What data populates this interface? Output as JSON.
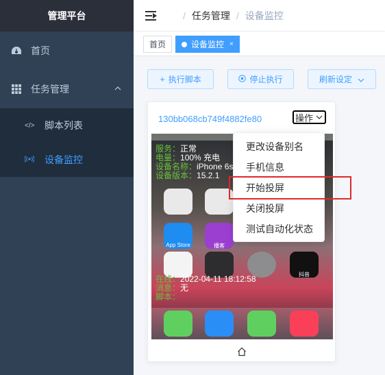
{
  "app": {
    "title": "管理平台"
  },
  "sidebar": {
    "items": [
      {
        "label": "首页",
        "icon": "dashboard-icon"
      },
      {
        "label": "任务管理",
        "icon": "table-grid-icon",
        "expanded": true
      }
    ],
    "subitems": [
      {
        "label": "脚本列表",
        "icon": "code-icon"
      },
      {
        "label": "设备监控",
        "icon": "broadcast-icon",
        "active": true
      }
    ]
  },
  "breadcrumb": {
    "level1": "任务管理",
    "level2": "设备监控"
  },
  "tags": [
    {
      "label": "首页"
    },
    {
      "label": "设备监控",
      "active": true,
      "close": "×"
    }
  ],
  "toolbar": {
    "run_label": "执行脚本",
    "stop_label": "停止执行",
    "refresh_label": "刷新设定"
  },
  "device": {
    "id": "130bb068cb749f4882fe80",
    "ops_label": "操作",
    "overlay_top": [
      {
        "key": "服务：",
        "value": "正常"
      },
      {
        "key": "电量：",
        "value": "100% 充电"
      },
      {
        "key": "设备名称：",
        "value": "iPhone 6s"
      },
      {
        "key": "设备版本：",
        "value": "15.2.1"
      }
    ],
    "overlay_bottom": [
      {
        "key": "在线：",
        "value": "2022-04-11 18:12:58"
      },
      {
        "key": "消息：",
        "value": "无"
      },
      {
        "key": "脚本：",
        "value": ""
      }
    ],
    "apps": [
      {
        "label": "App Store",
        "color": "#1e8cf0"
      },
      {
        "label": "播客",
        "color": "#9b3fd1"
      },
      {
        "label": "",
        "color": "#f4f4f4"
      },
      {
        "label": "",
        "color": "#f3f3f3"
      },
      {
        "label": "",
        "color": "#2d2d2f"
      },
      {
        "label": "",
        "color": "#8d8d90"
      },
      {
        "label": "抖音",
        "color": "#111111"
      }
    ],
    "dock_apps": [
      "#5fd05f",
      "#2a8ef6",
      "#5fd05f",
      "#fa3f58"
    ]
  },
  "dropdown": {
    "items": [
      {
        "label": "更改设备别名"
      },
      {
        "label": "手机信息"
      },
      {
        "label": "开始投屏",
        "highlighted": true
      },
      {
        "label": "关闭投屏"
      },
      {
        "label": "测试自动化状态"
      }
    ]
  },
  "colors": {
    "accent": "#409eff",
    "sidebar_bg": "#304156",
    "status_ok": "#67c23a",
    "highlight": "#e02828"
  }
}
